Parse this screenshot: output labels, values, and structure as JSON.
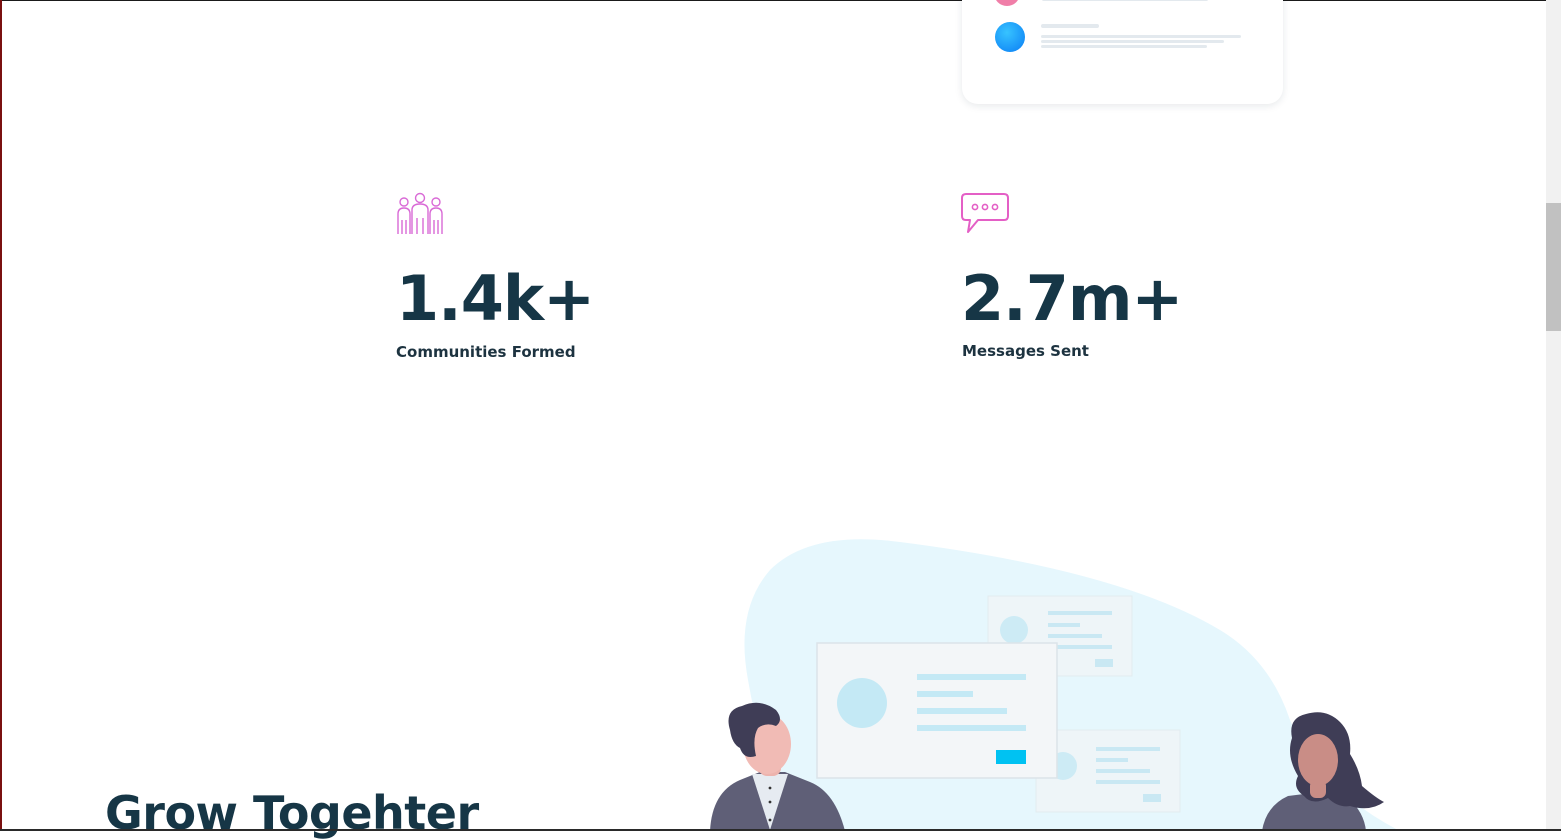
{
  "stats": [
    {
      "icon": "community-icon",
      "value": "1.4k+",
      "label": "Communities Formed"
    },
    {
      "icon": "chat-bubble-icon",
      "value": "2.7m+",
      "label": "Messages Sent"
    }
  ],
  "section": {
    "heading": "Grow Togehter"
  },
  "colors": {
    "text": "#163646",
    "accent_pink": "#e45fc6",
    "accent_blue": "#0fb5ef",
    "blob": "#e6f7fd"
  }
}
